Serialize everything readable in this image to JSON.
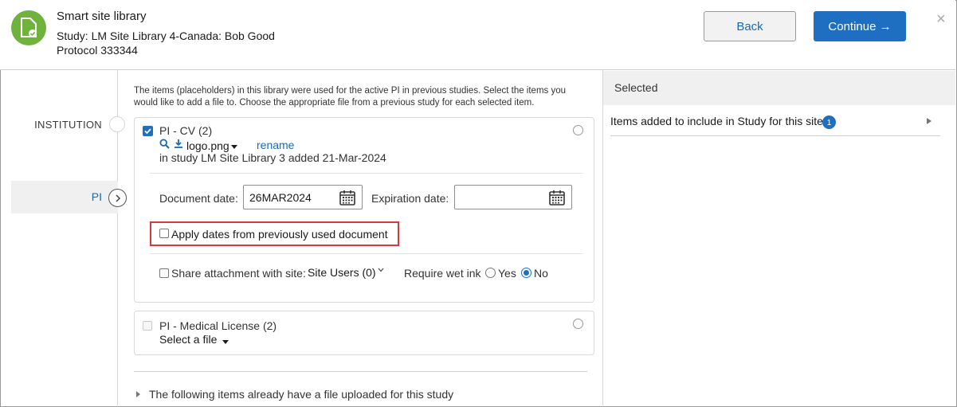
{
  "header": {
    "title": "Smart site library",
    "study_line": "Study: LM Site Library 4-Canada: Bob Good",
    "protocol_line": "Protocol 333344",
    "back_label": "Back",
    "continue_label": "Continue →",
    "close_label": "×"
  },
  "sidebar": {
    "items": [
      {
        "label": "INSTITUTION",
        "active": false
      },
      {
        "label": "PI",
        "active": true
      }
    ]
  },
  "main": {
    "intro": "The items (placeholders) in this library were used for the active PI in previous studies. Select the items you would like to add a file to. Choose the appropriate file from a previous study for each selected item.",
    "item1": {
      "title": "PI - CV (2)",
      "checked": true,
      "file_name": "logo.png",
      "rename_label": "rename",
      "study_note": "in study LM Site Library 3 added 21-Mar-2024",
      "document_date_label": "Document date:",
      "document_date_value": "26MAR2024",
      "expiration_date_label": "Expiration date:",
      "expiration_date_value": "",
      "apply_dates_label": "Apply dates from previously used document",
      "share_label": "Share attachment with site:",
      "share_value": "Site Users (0)",
      "wet_ink_label": "Require wet ink",
      "yes_label": "Yes",
      "no_label": "No",
      "wet_ink_selected": "No"
    },
    "item2": {
      "title": "PI - Medical License (2)",
      "checked": false,
      "select_file_label": "Select a file"
    },
    "following_label": "The following items already have a file uploaded for this study"
  },
  "right_panel": {
    "header": "Selected",
    "items_label": "Items added to include in Study for this site",
    "badge_count": "1"
  },
  "colors": {
    "accent": "#1e6fc2",
    "app_icon": "#6fb23c",
    "highlight_border": "#d9383d"
  }
}
